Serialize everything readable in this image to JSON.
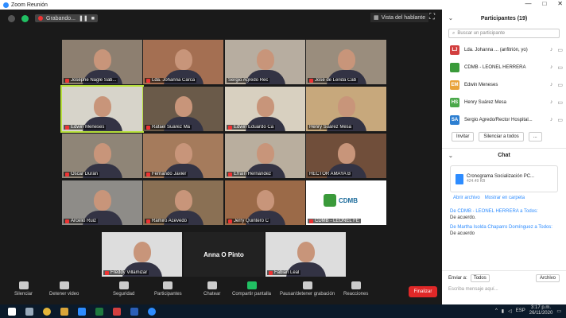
{
  "window": {
    "title": "Zoom Reunión",
    "controls": [
      "—",
      "□",
      "✕"
    ]
  },
  "topbar": {
    "recording": "Grabando...",
    "speaker_view": "Vista del hablante"
  },
  "tiles": [
    {
      "name": "Joséphe Nagle Sab...",
      "mic_off": true,
      "active": false,
      "bg": "#8d7f70"
    },
    {
      "name": "Lda. Johanna Carca",
      "mic_off": true,
      "active": false,
      "bg": "#a46f52"
    },
    {
      "name": "Sergio Agredo Rec",
      "mic_off": false,
      "active": false,
      "bg": "#b7ada0"
    },
    {
      "name": "José de Lerida Cab",
      "mic_off": true,
      "active": false,
      "bg": "#9a8d7d"
    },
    {
      "name": "Edwin Meneses",
      "mic_off": true,
      "active": true,
      "bg": "#d7d4ca"
    },
    {
      "name": "Rafael Suárez Ma",
      "mic_off": true,
      "active": false,
      "bg": "#6a5a49"
    },
    {
      "name": "Edwin Eduardo Ca",
      "mic_off": true,
      "active": false,
      "bg": "#d8d0c0"
    },
    {
      "name": "Henry Suárez Mesa",
      "mic_off": false,
      "active": false,
      "bg": "#c7a87c"
    },
    {
      "name": "Oscar Durán",
      "mic_off": true,
      "active": false,
      "bg": "#8f8577"
    },
    {
      "name": "Fernando Javier",
      "mic_off": true,
      "active": false,
      "bg": "#a57b5c"
    },
    {
      "name": "Efraín Hernández",
      "mic_off": true,
      "active": false,
      "bg": "#b9ae9e"
    },
    {
      "name": "HÉCTOR AMAYA B",
      "mic_off": false,
      "active": false,
      "bg": "#704e3a"
    },
    {
      "name": "Arcelio Ruiz",
      "mic_off": true,
      "active": false,
      "bg": "#8e8c88"
    },
    {
      "name": "Ramiro Acevedo",
      "mic_off": true,
      "active": false,
      "bg": "#8a7054"
    },
    {
      "name": "Jerry Quintero C",
      "mic_off": true,
      "active": false,
      "bg": "#9b6a48"
    },
    {
      "name": "CDMB - LEONEL FE",
      "mic_off": true,
      "active": false,
      "bg": "#ffffff",
      "logo": "CDMB"
    },
    {
      "name": "Freddy Villamizar",
      "mic_off": true,
      "active": false,
      "bg": "#dddddd"
    },
    {
      "name": "Anna O Pinto",
      "mic_off": false,
      "active": false,
      "bg": "#222222",
      "name_only": true
    },
    {
      "name": "Fabian Leal",
      "mic_off": true,
      "active": false,
      "bg": "#dddddd"
    }
  ],
  "toolbar": {
    "items": [
      "Silenciar",
      "Detener video",
      "Seguridad",
      "Participantes",
      "Chatear",
      "Compartir pantalla",
      "Pausar/detener grabación",
      "Reacciones"
    ],
    "participants_count": "20",
    "end": "Finalizar"
  },
  "panel": {
    "title": "Participantes (19)",
    "search_placeholder": "Buscar un participante",
    "participants": [
      {
        "initials": "LJ",
        "name": "Lda. Johanna ... (anfitrión, yo)",
        "color": "#d23f3f"
      },
      {
        "initials": "",
        "name": "CDMB - LEONEL HERRERA",
        "color": "#3a9a3a"
      },
      {
        "initials": "EM",
        "name": "Edwin Meneses",
        "color": "#e8a33a"
      },
      {
        "initials": "HS",
        "name": "Henry Suárez Mesa",
        "color": "#4aa84a"
      },
      {
        "initials": "SA",
        "name": "Sergio Agredo/Rector Hospital...",
        "color": "#2d7fd1"
      }
    ],
    "buttons": [
      "Invitar",
      "Silenciar a todos",
      "..."
    ],
    "chat_title": "Chat",
    "file": {
      "name": "Cronograma Socialización PC...",
      "size": "424.49 KB"
    },
    "file_actions": [
      "Abrir archivo",
      "Mostrar en carpeta"
    ],
    "messages": [
      {
        "who": "De CDMB - LEONEL HERRERA a Todos:",
        "text": "De acuerdo."
      },
      {
        "who": "De Martha Isolda Chaparro Domínguez a Todos:",
        "text": "De acuerdo"
      }
    ],
    "send_to_label": "Enviar a:",
    "send_to_value": "Todos",
    "file_button": "Archivo",
    "message_placeholder": "Escriba mensaje aquí..."
  },
  "taskbar": {
    "time": "3:17 p.m.",
    "date": "26/11/2020",
    "lang": "ESP"
  }
}
